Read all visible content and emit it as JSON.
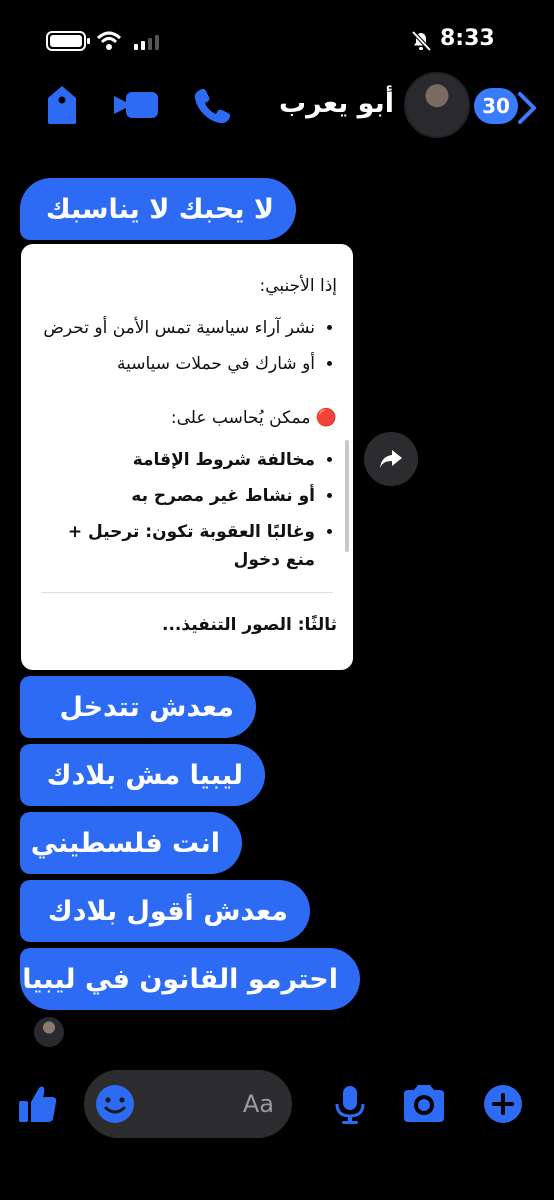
{
  "status_bar": {
    "time": "8:33"
  },
  "header": {
    "unread_count": "30",
    "contact_name": "أبو يعرب"
  },
  "messages": [
    {
      "text": "لا يحبك لا يناسبك"
    },
    {
      "text": "معدش تتدخل"
    },
    {
      "text": "ليبيا مش بلادك"
    },
    {
      "text": "انت فلسطيني"
    },
    {
      "text": "معدش أقول بلادك"
    },
    {
      "text": "احترمو القانون في ليبيا"
    }
  ],
  "card": {
    "heading1": "إذا الأجنبي:",
    "list1": [
      "نشر آراء سياسية تمس الأمن أو تحرض",
      "أو شارك في حملات سياسية"
    ],
    "heading2": "🔴 ممكن يُحاسب على:",
    "list2": [
      "مخالفة شروط الإقامة",
      "أو نشاط غير مصرح به",
      "وغالبًا العقوبة تكون: ترحيل + منع دخول"
    ],
    "cut_text": "ثالثًا: الصور التنفيذ..."
  },
  "composer": {
    "placeholder": "Aa"
  },
  "colors": {
    "accent": "#2d6bf5",
    "background": "#000000",
    "surface": "#2c2c2e"
  }
}
